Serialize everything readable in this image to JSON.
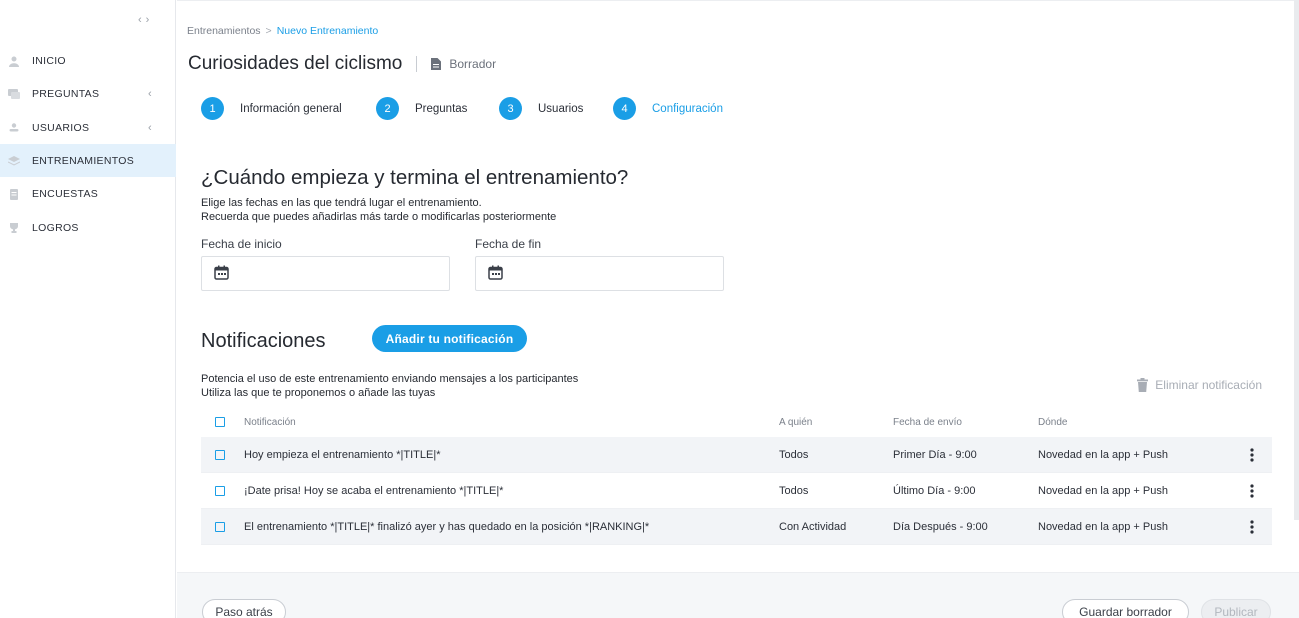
{
  "sidebar": {
    "collapse_icon": "chevrons-left-right-icon",
    "items": [
      {
        "label": "INICIO",
        "icon": "user-icon"
      },
      {
        "label": "PREGUNTAS",
        "icon": "chat-icon"
      },
      {
        "label": "USUARIOS",
        "icon": "person-icon"
      },
      {
        "label": "ENTRENAMIENTOS",
        "icon": "layers-icon"
      },
      {
        "label": "ENCUESTAS",
        "icon": "clipboard-icon"
      },
      {
        "label": "LOGROS",
        "icon": "trophy-icon"
      }
    ]
  },
  "breadcrumb": {
    "parent": "Entrenamientos",
    "separator": ">",
    "current": "Nuevo Entrenamiento"
  },
  "header": {
    "title": "Curiosidades del ciclismo",
    "status": "Borrador"
  },
  "steps": [
    {
      "num": "1",
      "label": "Información general"
    },
    {
      "num": "2",
      "label": "Preguntas"
    },
    {
      "num": "3",
      "label": "Usuarios"
    },
    {
      "num": "4",
      "label": "Configuración"
    }
  ],
  "schedule": {
    "heading": "¿Cuándo empieza y termina el entrenamiento?",
    "line1": "Elige las fechas en las que tendrá lugar el entrenamiento.",
    "line2": "Recuerda que puedes añadirlas más tarde o modificarlas posteriormente",
    "start_label": "Fecha de inicio",
    "start_value": "",
    "end_label": "Fecha de fin",
    "end_value": ""
  },
  "notifications": {
    "heading": "Notificaciones",
    "add_button": "Añadir tu notificación",
    "line1": "Potencia el uso de este entrenamiento enviando mensajes a los participantes",
    "line2": "Utiliza las que te proponemos o añade las tuyas",
    "delete_button": "Eliminar notificación",
    "columns": [
      "Notificación",
      "A quién",
      "Fecha de envío",
      "Dónde"
    ],
    "rows": [
      {
        "text": "Hoy empieza el entrenamiento *|TITLE|*",
        "who": "Todos",
        "date": "Primer Día - 9:00",
        "where": "Novedad en la app + Push"
      },
      {
        "text": "¡Date prisa! Hoy se acaba el entrenamiento *|TITLE|*",
        "who": "Todos",
        "date": "Último Día - 9:00",
        "where": "Novedad en la app + Push"
      },
      {
        "text": "El entrenamiento *|TITLE|* finalizó ayer y has quedado en la posición *|RANKING|*",
        "who": "Con Actividad",
        "date": "Día Después - 9:00",
        "where": "Novedad en la app + Push"
      }
    ]
  },
  "footer": {
    "back": "Paso atrás",
    "save": "Guardar borrador",
    "publish": "Publicar"
  },
  "colors": {
    "accent": "#1a9ee6",
    "active_bg": "#e3f1fc"
  }
}
